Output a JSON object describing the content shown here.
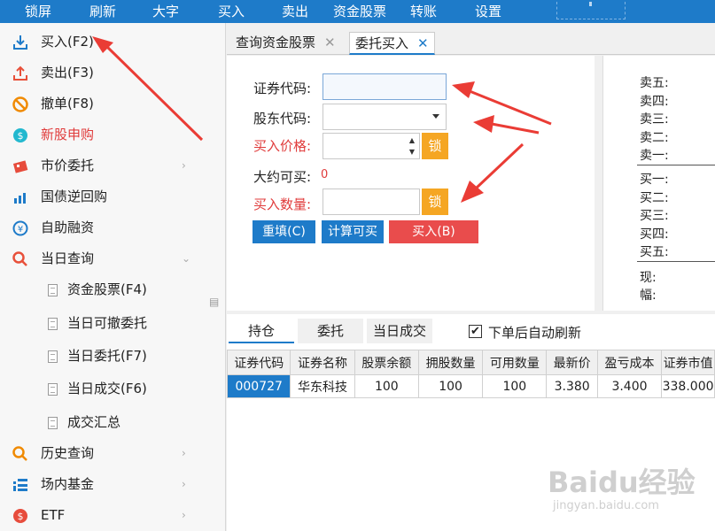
{
  "menu": [
    "锁屏",
    "刷新",
    "大字",
    "买入",
    "卖出",
    "资金股票",
    "转账",
    "设置"
  ],
  "sidebar": {
    "items": [
      {
        "label": "买入(F2)",
        "icon": "download-icon"
      },
      {
        "label": "卖出(F3)",
        "icon": "upload-icon"
      },
      {
        "label": "撤单(F8)",
        "icon": "cancel-icon"
      },
      {
        "label": "新股申购",
        "icon": "ipo-icon"
      },
      {
        "label": "市价委托",
        "icon": "market-order-icon"
      },
      {
        "label": "国债逆回购",
        "icon": "bond-chart-icon"
      },
      {
        "label": "自助融资",
        "icon": "financing-icon"
      },
      {
        "label": "当日查询",
        "icon": "search-icon"
      },
      {
        "label": "资金股票(F4)",
        "icon": "document-icon"
      },
      {
        "label": "当日可撤委托",
        "icon": "document-icon"
      },
      {
        "label": "当日委托(F7)",
        "icon": "document-icon"
      },
      {
        "label": "当日成交(F6)",
        "icon": "document-icon"
      },
      {
        "label": "成交汇总",
        "icon": "document-icon"
      },
      {
        "label": "历史查询",
        "icon": "search-icon"
      },
      {
        "label": "场内基金",
        "icon": "fund-icon"
      },
      {
        "label": "ETF",
        "icon": "etf-icon"
      }
    ]
  },
  "tabs": [
    {
      "label": "查询资金股票",
      "active": false
    },
    {
      "label": "委托买入",
      "active": true
    }
  ],
  "form": {
    "code_label": "证券代码:",
    "code_value": "",
    "holder_label": "股东代码:",
    "holder_value": "",
    "price_label": "买入价格:",
    "price_value": "",
    "lock_label": "锁",
    "available_label": "大约可买:",
    "available_value": "0",
    "qty_label": "买入数量:",
    "qty_value": "",
    "reset_button": "重填(C)",
    "calc_button": "计算可买",
    "buy_button": "买入(B)"
  },
  "order_book": {
    "sell": [
      "卖五:",
      "卖四:",
      "卖三:",
      "卖二:",
      "卖一:"
    ],
    "buy": [
      "买一:",
      "买二:",
      "买三:",
      "买四:",
      "买五:"
    ],
    "current": "现:",
    "change": "幅:"
  },
  "bottom_tabs": [
    {
      "label": "持仓",
      "active": true
    },
    {
      "label": "委托",
      "active": false
    },
    {
      "label": "当日成交",
      "active": false
    }
  ],
  "auto_refresh": {
    "label": "下单后自动刷新",
    "checked": true,
    "check_glyph": "✔"
  },
  "holdings": {
    "columns": [
      "证券代码",
      "证券名称",
      "股票余额",
      "拥股数量",
      "可用数量",
      "最新价",
      "盈亏成本",
      "证券市值"
    ],
    "rows": [
      [
        "000727",
        "华东科技",
        "100",
        "100",
        "100",
        "3.380",
        "3.400",
        "338.000"
      ]
    ]
  },
  "watermark": {
    "main": "Baidu经验",
    "sub": "jingyan.baidu.com"
  },
  "colors": {
    "accent": "#1e7bc9",
    "red": "#e03b3b",
    "lock": "#f5a623",
    "buy_button": "#e94c4c",
    "arrow": "#ea3c35"
  }
}
